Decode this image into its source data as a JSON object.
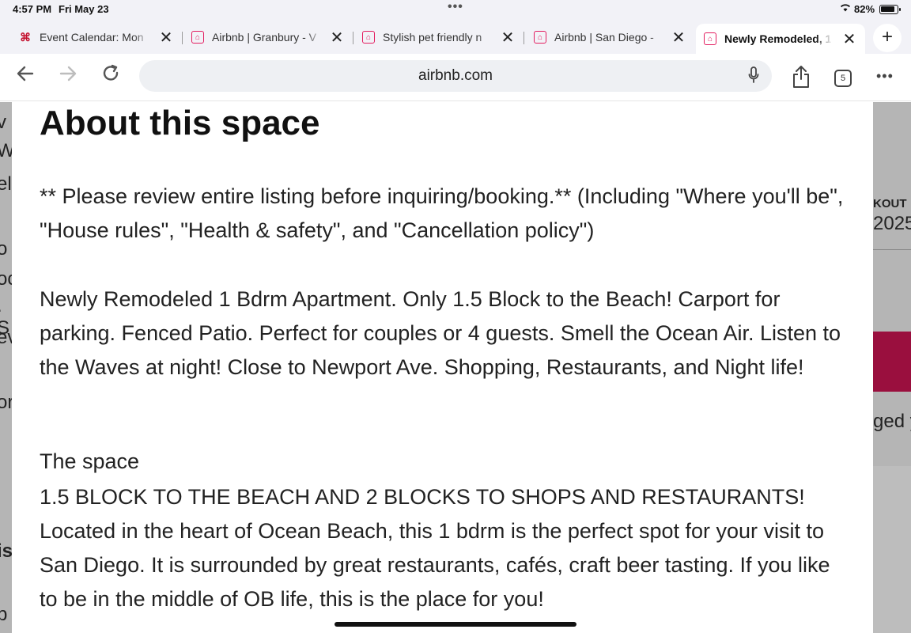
{
  "status_bar": {
    "time": "4:57 PM",
    "date": "Fri May 23",
    "battery": "82%"
  },
  "tabs": [
    {
      "title": "Event Calendar: Mon",
      "icon": "calendar-logo-icon"
    },
    {
      "title": "Airbnb | Granbury - V",
      "icon": "airbnb-logo-icon"
    },
    {
      "title": "Stylish pet friendly n",
      "icon": "airbnb-logo-icon"
    },
    {
      "title": "Airbnb | San Diego -",
      "icon": "airbnb-logo-icon"
    },
    {
      "title": "Newly Remodeled, 1",
      "icon": "airbnb-logo-icon",
      "active": true
    }
  ],
  "toolbar": {
    "url": "airbnb.com",
    "tab_count": "5"
  },
  "background": {
    "left_fragments": [
      "v",
      "W",
      "ell",
      "o",
      "oc",
      ". S",
      "ev",
      "or",
      "is",
      "b"
    ],
    "right_checkout": "KOUT",
    "right_year": "2025",
    "right_text": "ged y"
  },
  "sheet": {
    "heading": "About this space",
    "p1": "** Please review entire listing before inquiring/booking.** (Including \"Where you'll be\", \"House rules\", \"Health & safety\", and \"Cancellation policy\")",
    "p2": "Newly Remodeled 1 Bdrm Apartment. Only 1.5 Block to the Beach! Carport for parking. Fenced Patio. Perfect for couples or 4 guests. Smell the Ocean Air. Listen to the Waves at night! Close to Newport Ave. Shopping, Restaurants, and Night life!",
    "space_heading": "The space",
    "p3": "1.5 BLOCK TO THE BEACH AND 2 BLOCKS TO SHOPS AND RESTAURANTS! Located in the heart of Ocean Beach, this 1 bdrm is the perfect spot for your visit to San Diego. It is surrounded by great restaurants, cafés, craft beer tasting. If you like to be in the middle of OB life, this is the place for you!"
  },
  "colors": {
    "airbnb": "#e31c5f",
    "reserve_button": "#9a0f3e"
  }
}
